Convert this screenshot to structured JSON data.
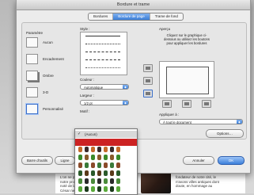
{
  "window": {
    "title": "Bordure et trame"
  },
  "tabs": [
    {
      "label": "Bordures",
      "active": false
    },
    {
      "label": "Bordure de page",
      "active": true
    },
    {
      "label": "Trame de fond",
      "active": false
    }
  ],
  "presets": {
    "label": "Paramètre",
    "items": [
      {
        "label": "Aucun",
        "selected": false
      },
      {
        "label": "Encadrement",
        "selected": false
      },
      {
        "label": "Ombre",
        "selected": false
      },
      {
        "label": "3-D",
        "selected": false
      },
      {
        "label": "Personnalisé",
        "selected": true
      }
    ]
  },
  "style": {
    "label": "Style :"
  },
  "color": {
    "label": "Couleur :",
    "value": "Automatique"
  },
  "width": {
    "label": "Largeur :",
    "value": "1/2 pt"
  },
  "art": {
    "label": "Motif :",
    "selected": "(Aucun)"
  },
  "preview": {
    "label": "Aperçu",
    "hint": "Cliquez sur le graphique ci-dessous ou utilisez les boutons pour appliquer les bordures"
  },
  "apply": {
    "label": "Appliquer à :",
    "value": "À tout le document"
  },
  "buttons": {
    "options": "Options…",
    "toolbar": "Barre d'outils",
    "horizontal_line": "Ligne",
    "cancel": "Annuler",
    "ok": "OK"
  },
  "document": {
    "left_text": "L'on ne peu\nnotre projet\nnoté de la\nCésar ne fu",
    "right_text": "fondateur de notre cité, le\nn'avons villes antiques dont\ndoute, en hommage au"
  },
  "colors": {
    "accent": "#3c7fd8",
    "selection": "#3b6fc8"
  }
}
